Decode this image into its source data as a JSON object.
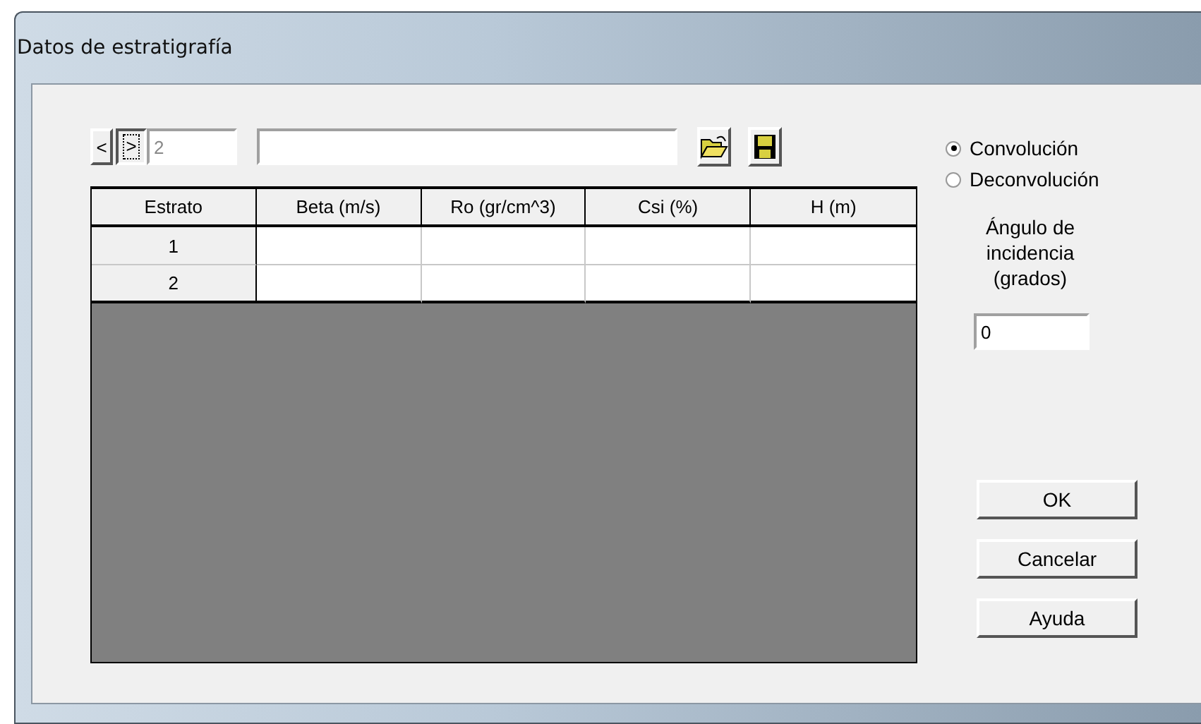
{
  "window": {
    "title": "Datos de estratigrafía"
  },
  "navigator": {
    "prev": "<",
    "next": ">",
    "next_selected": true,
    "record": "2"
  },
  "table": {
    "columns": [
      "Estrato",
      "Beta (m/s)",
      "Ro (gr/cm^3)",
      "Csi (%)",
      "H (m)"
    ],
    "rows": [
      {
        "cells": [
          "1",
          "",
          "",
          "",
          ""
        ]
      },
      {
        "cells": [
          "2",
          "",
          "",
          "",
          ""
        ]
      }
    ]
  },
  "mode": [
    {
      "label": "Convolución",
      "selected": true
    },
    {
      "label": "Deconvolución",
      "selected": false
    }
  ],
  "angle": {
    "label": "Ángulo de incidencia (grados)",
    "value": "0"
  },
  "buttons": [
    "OK",
    "Cancelar",
    "Ayuda"
  ]
}
